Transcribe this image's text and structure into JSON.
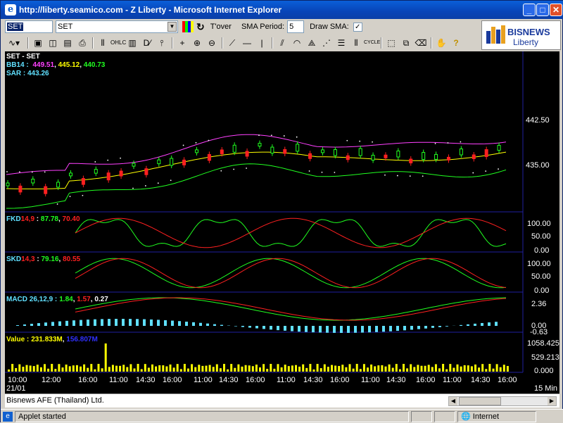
{
  "window": {
    "title": "http://liberty.seamico.com - Z Liberty - Microsoft Internet Explorer"
  },
  "toolbar": {
    "symbol_input": "SET",
    "symbol_select": "SET",
    "turnover_label": "T'over",
    "sma_period_label": "SMA Period:",
    "sma_period_value": "5",
    "draw_sma_label": "Draw SMA:",
    "draw_sma_checked": "✓"
  },
  "logo": {
    "brand": "BISNEWS",
    "sub": "Liberty"
  },
  "footer": {
    "company": "Bisnews AFE (Thailand) Ltd."
  },
  "status": {
    "left": "Applet started",
    "zone": "Internet"
  },
  "colors": {
    "red": "#ff2020",
    "green": "#20ff20",
    "yellow": "#ffff00",
    "cyan": "#60e0ff",
    "magenta": "#ff40ff",
    "blue": "#3030ff",
    "white": "#ffffff",
    "frame": "#2020a0"
  },
  "chart_data": [
    {
      "type": "line",
      "panel": "price",
      "legend": {
        "symbol": "SET - SET",
        "bb": "BB14 :",
        "bb_upper": "449.51",
        "bb_mid": "445.12",
        "bb_lower": "440.73",
        "sar": "SAR : 443.26"
      },
      "ylabels": [
        "442.50",
        "435.00"
      ],
      "yvalues": [
        442.5,
        435.0
      ],
      "ylim": [
        426,
        458
      ]
    },
    {
      "type": "line",
      "panel": "fkd",
      "legend": {
        "name": "FKD",
        "params": "14,9",
        "v1": "87.78",
        "v2": "70.40"
      },
      "ylabels": [
        "100.00",
        "50.00",
        "0.00"
      ],
      "ylim": [
        0,
        100
      ]
    },
    {
      "type": "line",
      "panel": "skd",
      "legend": {
        "name": "SKD",
        "params": "14,3",
        "v1": "79.16",
        "v2": "80.55"
      },
      "ylabels": [
        "100.00",
        "50.00",
        "0.00"
      ],
      "ylim": [
        0,
        100
      ]
    },
    {
      "type": "bar",
      "panel": "macd",
      "legend": {
        "name": "MACD 26,12,9 :",
        "v1": "1.84",
        "v2": "1.57",
        "v3": "0.27"
      },
      "ylabels": [
        "2.36",
        "0.00",
        "-0.63"
      ],
      "ylim": [
        -0.63,
        2.36
      ]
    },
    {
      "type": "bar",
      "panel": "value",
      "legend": {
        "name": "Value :",
        "v1": "231.833M",
        "v2": "156.807M"
      },
      "ylabels": [
        "1058.425",
        "529.213",
        "0.000"
      ],
      "ylim": [
        0,
        1058.425
      ]
    }
  ],
  "xaxis": {
    "labels": [
      "10:00",
      "12:00",
      "16:00",
      "11:00",
      "14:30",
      "16:00",
      "11:00",
      "14:30",
      "16:00",
      "11:00",
      "14:30",
      "16:00",
      "11:00",
      "14:30",
      "16:00",
      "11:00",
      "14:30",
      "16:00"
    ],
    "date": "21/01",
    "interval": "15 Min"
  }
}
